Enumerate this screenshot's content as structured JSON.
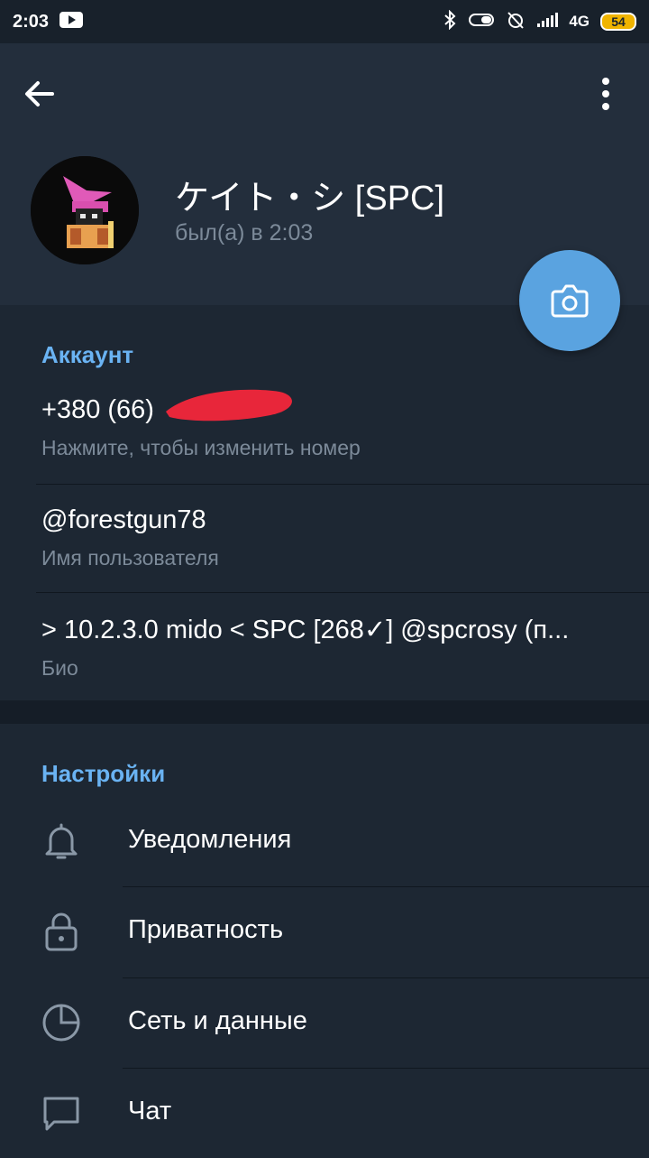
{
  "status_bar": {
    "time": "2:03",
    "network": "4G",
    "battery": "54",
    "icons": [
      "youtube-icon",
      "bluetooth-icon",
      "vibrate-icon",
      "alarm-off-icon",
      "signal-icon",
      "battery-icon"
    ]
  },
  "profile": {
    "name": "ケイト・シ [SPC]",
    "status": "был(а) в 2:03"
  },
  "account": {
    "title": "Аккаунт",
    "phone": "+380 (66)",
    "phone_hint": "Нажмите, чтобы изменить номер",
    "username": "@forestgun78",
    "username_label": "Имя пользователя",
    "bio": "> 10.2.3.0 mido < SPC [268✓] @spcrosy (п...",
    "bio_label": "Био"
  },
  "settings": {
    "title": "Настройки",
    "items": [
      {
        "label": "Уведомления",
        "icon": "bell-icon"
      },
      {
        "label": "Приватность",
        "icon": "lock-icon"
      },
      {
        "label": "Сеть и данные",
        "icon": "pie-chart-icon"
      },
      {
        "label": "Чат",
        "icon": "chat-bubble-icon"
      }
    ]
  },
  "colors": {
    "accent": "#6ab3f3",
    "fab": "#5aa3e0",
    "redaction": "#e8263a",
    "header_bg": "#232e3c",
    "body_bg": "#1d2733"
  }
}
